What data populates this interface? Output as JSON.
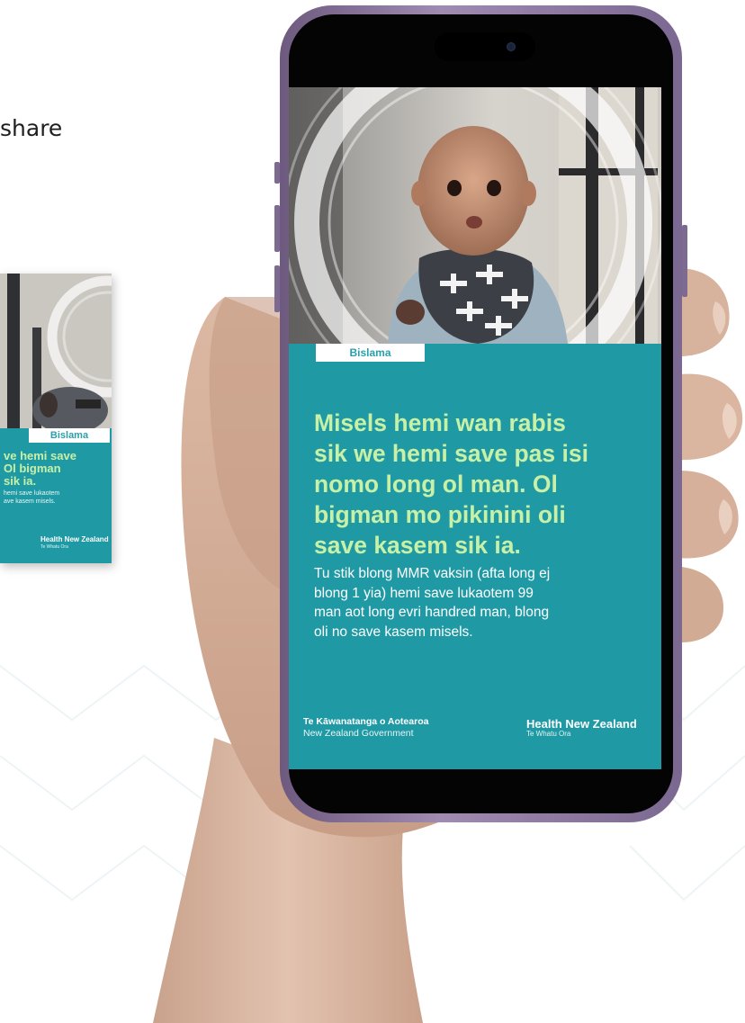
{
  "intro": {
    "share_text": "share"
  },
  "mini_poster": {
    "language_label": "Bislama",
    "heading_lines": "ve hemi save\nOl bigman\nsik ia.",
    "body_lines": "hemi save lukaotem\nave kasem misels.",
    "brand_name": "Health New Zealand",
    "brand_subtitle": "Te Whatu Ora"
  },
  "phone_screen": {
    "language_label": "Bislama",
    "headline": "Misels hemi wan rabis\nsik we hemi save pas isi\nnomo long ol man. Ol\nbigman mo pikinini oli\nsave kasem sik ia.",
    "body": "Tu stik blong MMR vaksin (afta long ej\nblong 1 yia) hemi save lukaotem 99\nman aot long evri handred man, blong\noli no save kasem misels.",
    "government_name": "Te Kāwanatanga o Aotearoa",
    "government_subtitle": "New Zealand Government",
    "brand_name": "Health New Zealand",
    "brand_subtitle": "Te Whatu Ora"
  },
  "colors": {
    "poster_teal": "#1f9aa5",
    "headline_green": "#c8f0a6",
    "chip_text": "#2aa0ac",
    "phone_frame": "#8a759d"
  }
}
